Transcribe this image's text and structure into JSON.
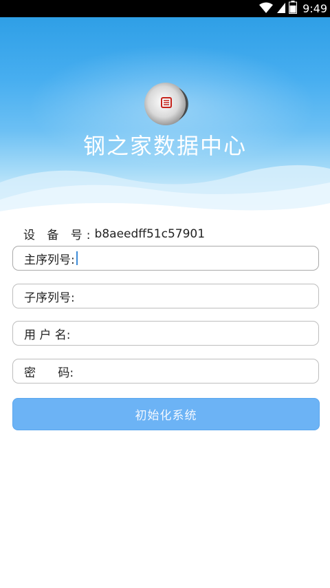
{
  "status_bar": {
    "time": "9:49",
    "icons": [
      "wifi-icon",
      "signal-icon",
      "battery-icon"
    ]
  },
  "header": {
    "title": "钢之家数据中心",
    "logo": "logo-icon"
  },
  "form": {
    "device_label": "设 备 号:",
    "device_id": "b8aeedff51c57901",
    "fields": [
      {
        "label": "主序列号:",
        "value": "",
        "focused": true
      },
      {
        "label": "子序列号:",
        "value": ""
      },
      {
        "label": "用 户 名:",
        "value": ""
      },
      {
        "label": "密      码:",
        "value": ""
      }
    ],
    "submit_label": "初始化系统"
  },
  "colors": {
    "header_blue": "#47aef0",
    "button_blue": "#6cb3f5",
    "field_border": "#bdbdbd"
  }
}
